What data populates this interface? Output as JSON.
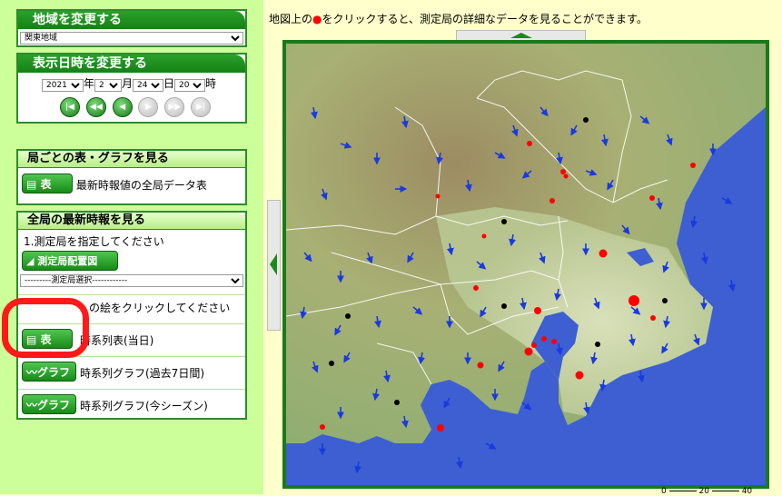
{
  "region": {
    "title": "地域を変更する",
    "selected": "関東地域"
  },
  "datetime": {
    "title": "表示日時を変更する",
    "year": "2021",
    "year_unit": "年",
    "month": "2",
    "month_unit": "月",
    "day": "24",
    "day_unit": "日",
    "hour": "20",
    "hour_unit": "時",
    "nav_buttons": [
      "first",
      "prev-day",
      "prev-hour",
      "next-hour",
      "next-day",
      "last"
    ]
  },
  "station_table": {
    "title": "局ごとの表・グラフを見る",
    "button": "表",
    "desc": "最新時報値の全局データ表"
  },
  "latest": {
    "title": "全局の最新時報を見る",
    "step1": "1.測定局を指定してください",
    "map_button": "測定局配置図",
    "station_select": "---------測定局選択------------",
    "step2": "の絵をクリックしてください",
    "rows": [
      {
        "button": "表",
        "label": "時系列表(当日)"
      },
      {
        "button": "グラフ",
        "label": "時系列グラフ(過去7日間)"
      },
      {
        "button": "グラフ",
        "label": "時系列グラフ(今シーズン)"
      }
    ]
  },
  "map": {
    "instruction_before": "地図上の",
    "instruction_marker": "●",
    "instruction_after": "をクリックすると、測定局の詳細なデータを見ることができます。",
    "colors": {
      "frame": "#1a7a1a",
      "sea": "#3a5fcf",
      "station": "#ff0000",
      "station_dark": "#000000",
      "arrow": "#1a3adf"
    }
  },
  "legend": {
    "v1": "0",
    "v2": "20",
    "v3": "40"
  }
}
